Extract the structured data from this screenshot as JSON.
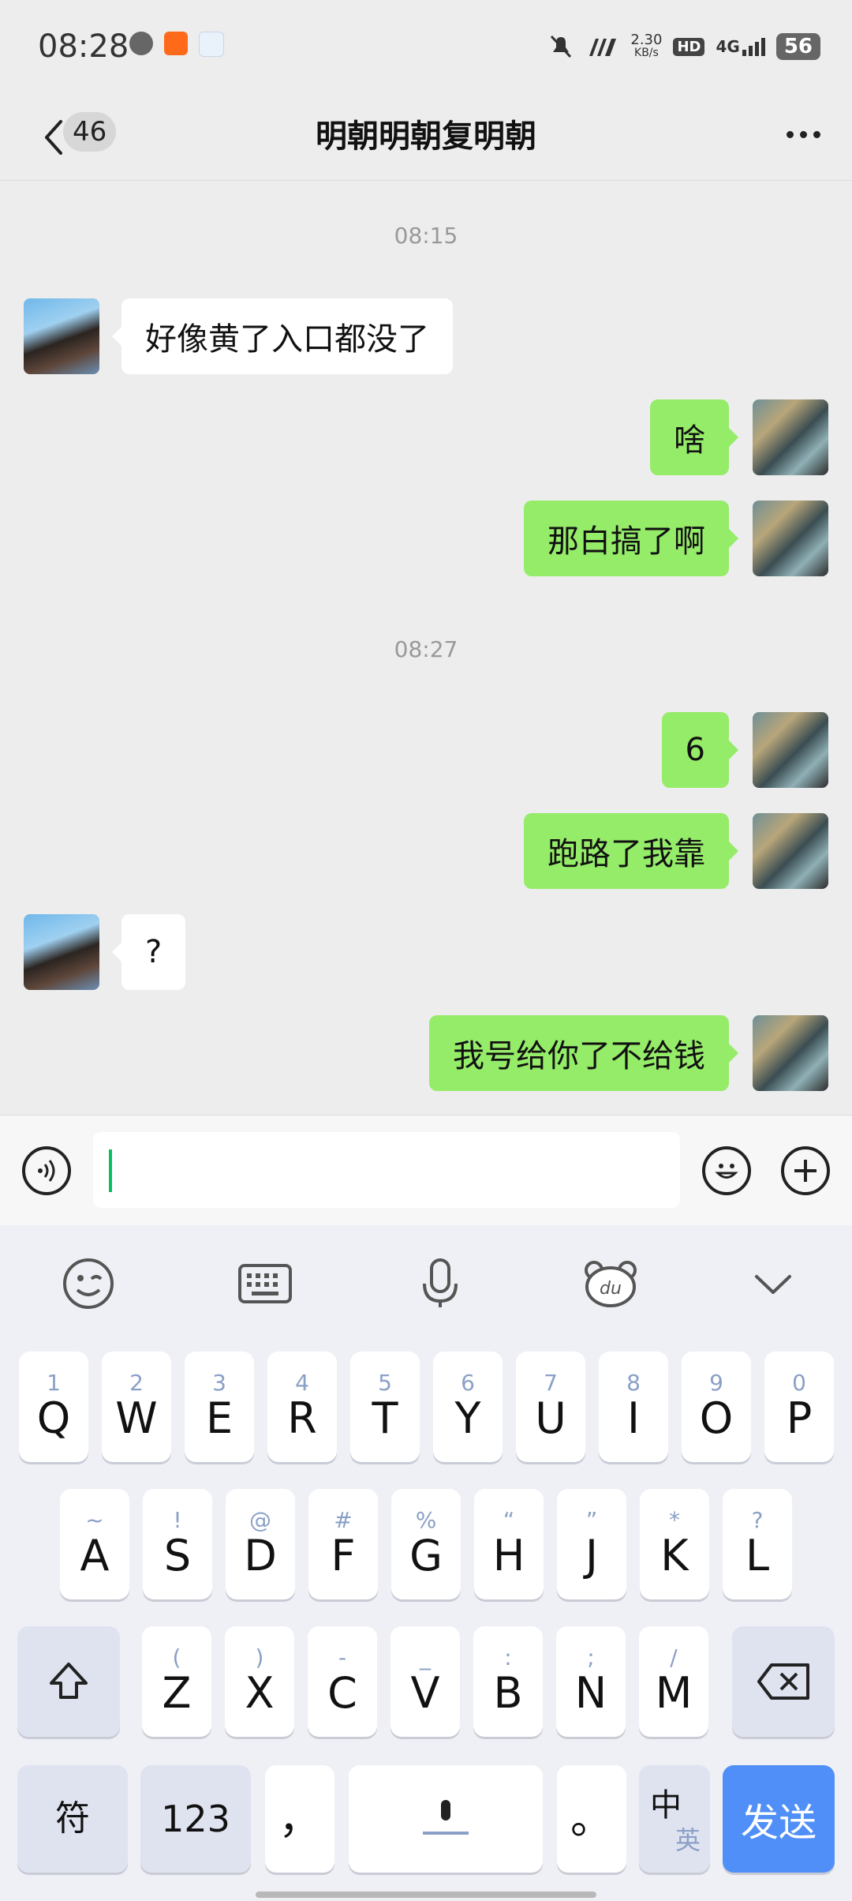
{
  "status_bar": {
    "time": "08:28",
    "net_speed_value": "2.30",
    "net_speed_unit": "KB/s",
    "hd": "HD",
    "network": "4G",
    "battery": "56"
  },
  "header": {
    "unread_count": "46",
    "title": "明朝明朝复明朝"
  },
  "chat": {
    "timestamps": [
      "08:15",
      "08:27"
    ],
    "messages": [
      {
        "side": "in",
        "text": "好像黄了入口都没了"
      },
      {
        "side": "out",
        "text": "啥"
      },
      {
        "side": "out",
        "text": "那白搞了啊"
      },
      {
        "side": "out",
        "text": "6"
      },
      {
        "side": "out",
        "text": "跑路了我靠"
      },
      {
        "side": "in",
        "text": "?"
      },
      {
        "side": "out",
        "text": "我号给你了不给钱"
      }
    ]
  },
  "keyboard": {
    "row1": [
      {
        "main": "Q",
        "sub": "1"
      },
      {
        "main": "W",
        "sub": "2"
      },
      {
        "main": "E",
        "sub": "3"
      },
      {
        "main": "R",
        "sub": "4"
      },
      {
        "main": "T",
        "sub": "5"
      },
      {
        "main": "Y",
        "sub": "6"
      },
      {
        "main": "U",
        "sub": "7"
      },
      {
        "main": "I",
        "sub": "8"
      },
      {
        "main": "O",
        "sub": "9"
      },
      {
        "main": "P",
        "sub": "0"
      }
    ],
    "row2": [
      {
        "main": "A",
        "sub": "~"
      },
      {
        "main": "S",
        "sub": "!"
      },
      {
        "main": "D",
        "sub": "@"
      },
      {
        "main": "F",
        "sub": "#"
      },
      {
        "main": "G",
        "sub": "%"
      },
      {
        "main": "H",
        "sub": "“"
      },
      {
        "main": "J",
        "sub": "”"
      },
      {
        "main": "K",
        "sub": "*"
      },
      {
        "main": "L",
        "sub": "?"
      }
    ],
    "row3": [
      {
        "main": "Z",
        "sub": "("
      },
      {
        "main": "X",
        "sub": ")"
      },
      {
        "main": "C",
        "sub": "-"
      },
      {
        "main": "V",
        "sub": "_"
      },
      {
        "main": "B",
        "sub": ":"
      },
      {
        "main": "N",
        "sub": ";"
      },
      {
        "main": "M",
        "sub": "/"
      }
    ],
    "symbols_label": "符",
    "numbers_label": "123",
    "comma": "，",
    "period": "。",
    "lang_zh": "中",
    "lang_en": "英",
    "send_label": "发送"
  },
  "colors": {
    "outgoing_bubble": "#95ec69",
    "incoming_bubble": "#ffffff",
    "send_key": "#4f8ff7",
    "caret": "#07c160"
  }
}
